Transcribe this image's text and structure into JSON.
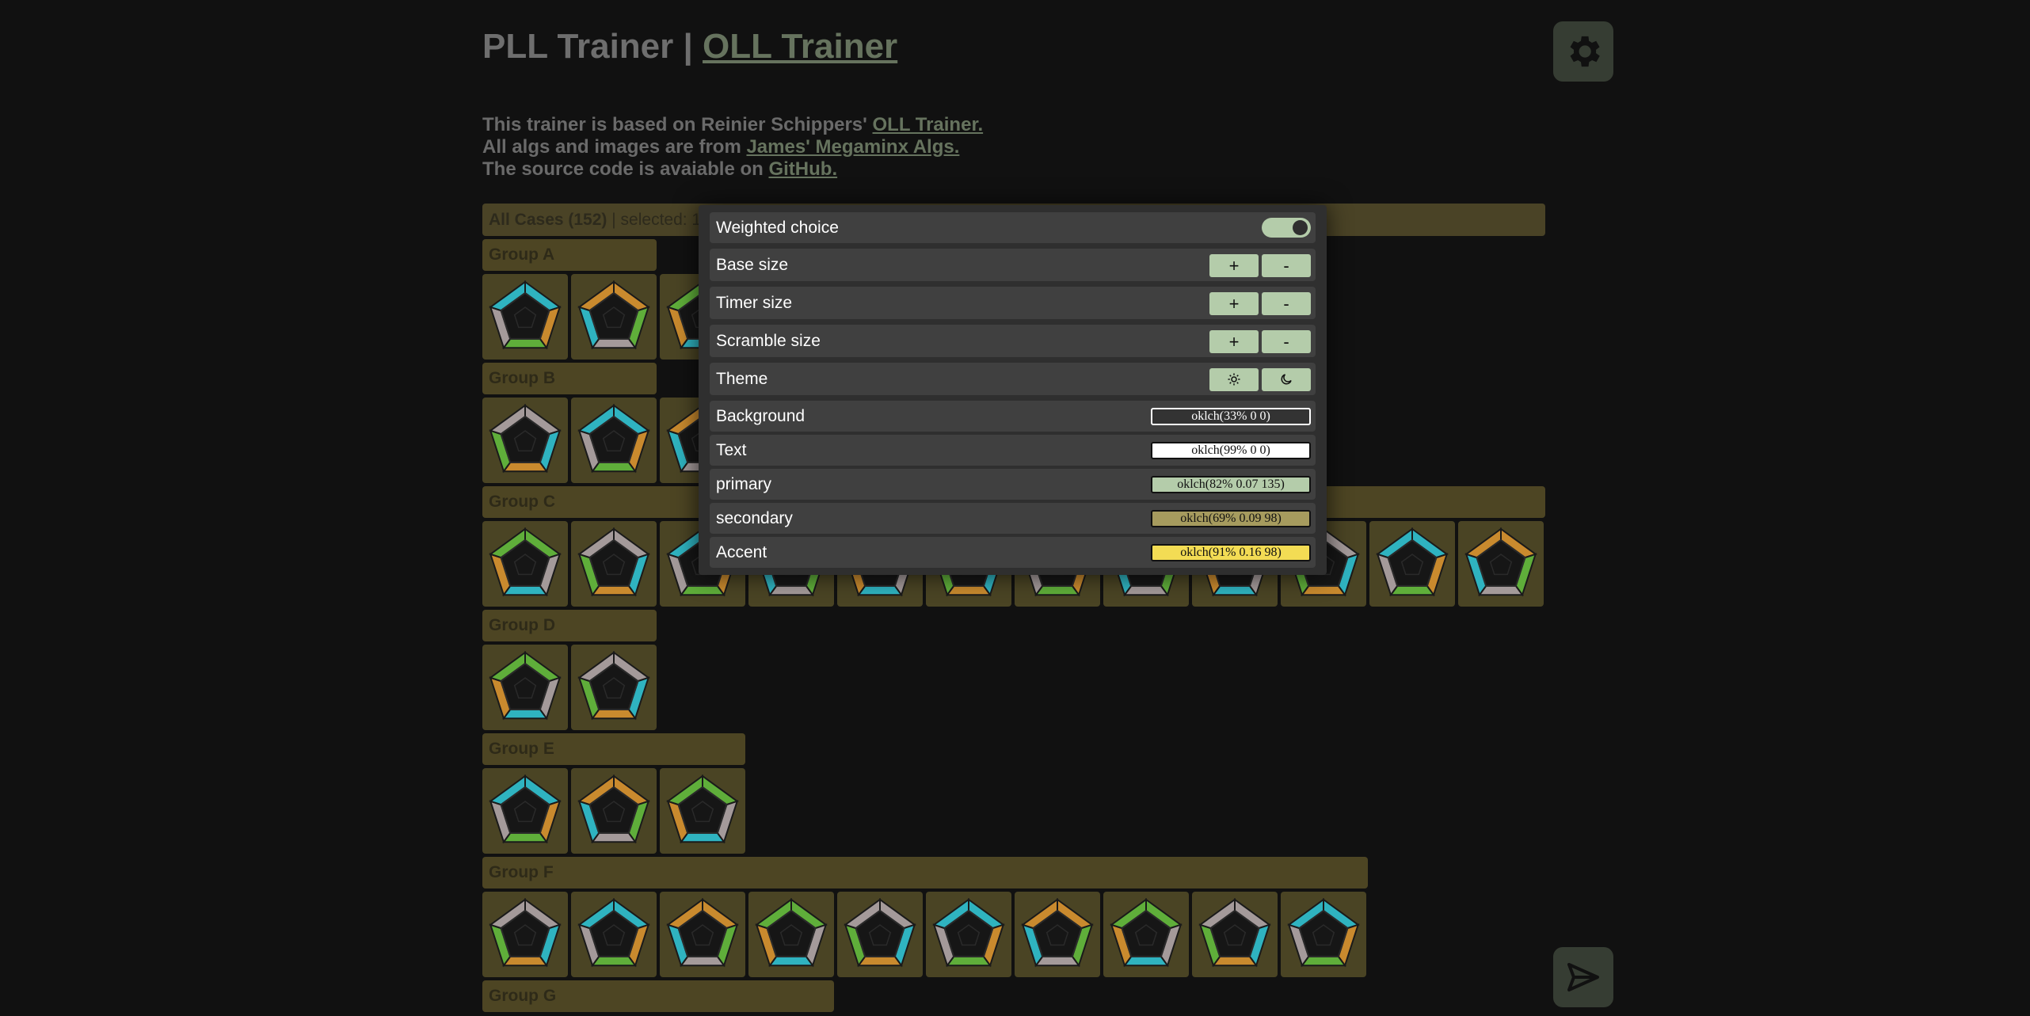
{
  "header": {
    "title_main": "PLL Trainer | ",
    "title_link": "OLL Trainer"
  },
  "info": {
    "line1_text": "This trainer is based on Reinier Schippers' ",
    "line1_link": "OLL Trainer.",
    "line2_text": "All algs and images are from ",
    "line2_link": "James' Megaminx Algs.",
    "line3_text": "The source code is avaiable on ",
    "line3_link": "GitHub."
  },
  "all_cases": {
    "label": "All Cases (152)",
    "selected": " | selected: 1"
  },
  "groups": [
    {
      "name": "Group A",
      "cases": 3
    },
    {
      "name": "Group B",
      "cases": 3
    },
    {
      "name": "Group C",
      "cases": 12
    },
    {
      "name": "Group D",
      "cases": 2
    },
    {
      "name": "Group E",
      "cases": 3
    },
    {
      "name": "Group F",
      "cases": 10
    },
    {
      "name": "Group G",
      "cases": 0
    }
  ],
  "settings": {
    "weighted_choice": {
      "label": "Weighted choice",
      "enabled": true
    },
    "base_size": {
      "label": "Base size",
      "plus": "+",
      "minus": "-"
    },
    "timer_size": {
      "label": "Timer size",
      "plus": "+",
      "minus": "-"
    },
    "scramble_size": {
      "label": "Scramble size",
      "plus": "+",
      "minus": "-"
    },
    "theme": {
      "label": "Theme",
      "light_icon": "sun-icon",
      "dark_icon": "moon-icon"
    },
    "background": {
      "label": "Background",
      "value": "oklch(33% 0 0)",
      "color": "#333333"
    },
    "text": {
      "label": "Text",
      "value": "oklch(99% 0 0)",
      "color": "#ffffff"
    },
    "primary": {
      "label": "primary",
      "value": "oklch(82% 0.07 135)",
      "color": "#b4ccaa"
    },
    "secondary": {
      "label": "secondary",
      "value": "oklch(69% 0.09 98)",
      "color": "#a69b5e"
    },
    "accent": {
      "label": "Accent",
      "value": "oklch(91% 0.16 98)",
      "color": "#f3dc54"
    }
  },
  "icons": {
    "settings": "gear-icon",
    "submit": "send-icon"
  }
}
